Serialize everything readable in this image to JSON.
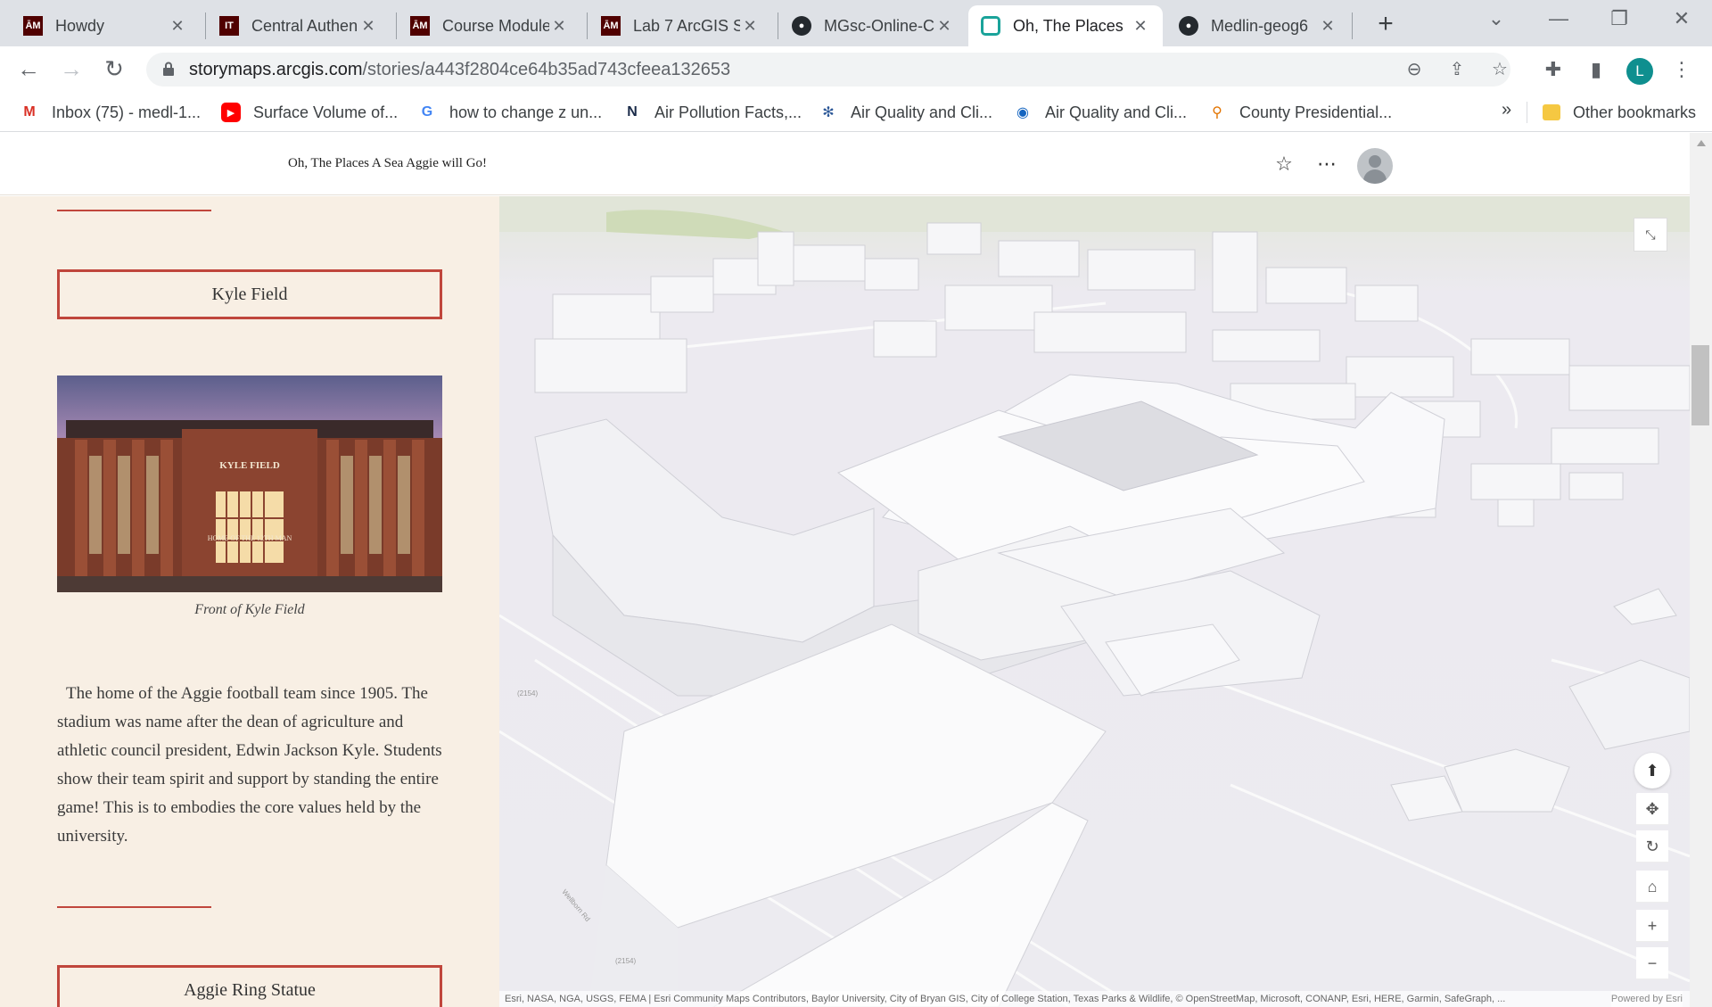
{
  "browser": {
    "tabs": [
      {
        "title": "Howdy",
        "icon": "tamu-icon",
        "active": false
      },
      {
        "title": "Central Authen",
        "icon": "it-icon",
        "active": false
      },
      {
        "title": "Course Module",
        "icon": "tamu-icon",
        "active": false
      },
      {
        "title": "Lab 7 ArcGIS S",
        "icon": "tamu-icon",
        "active": false
      },
      {
        "title": "MGsc-Online-C",
        "icon": "github-icon",
        "active": false
      },
      {
        "title": "Oh, The Places",
        "icon": "storymaps-icon",
        "active": true
      },
      {
        "title": "Medlin-geog6",
        "icon": "github-icon",
        "active": false
      }
    ],
    "url_domain": "storymaps.arcgis.com",
    "url_path": "/stories/a443f2804ce64b35ad743cfeea132653",
    "profile_initial": "L",
    "bookmarks": [
      {
        "label": "Inbox (75) - medl-1...",
        "icon": "gmail-icon",
        "color": "#d93025"
      },
      {
        "label": "Surface Volume of...",
        "icon": "youtube-icon",
        "color": "#ff0000"
      },
      {
        "label": "how to change z un...",
        "icon": "google-icon",
        "color": "#4285f4"
      },
      {
        "label": "Air Pollution Facts,...",
        "icon": "n-icon",
        "color": "#1a2b49"
      },
      {
        "label": "Air Quality and Cli...",
        "icon": "snowflake-icon",
        "color": "#2b5797"
      },
      {
        "label": "Air Quality and Cli...",
        "icon": "globe-icon",
        "color": "#1565c0"
      },
      {
        "label": "County Presidential...",
        "icon": "pin-icon",
        "color": "#e37400"
      }
    ],
    "bookmarks_more": "»",
    "other_bookmarks": "Other bookmarks"
  },
  "story": {
    "title": "Oh, The Places A Sea Aggie will Go!",
    "sections": [
      {
        "heading": "Kyle Field",
        "photo_sign_top": "KYLE FIELD",
        "photo_sign_bottom": "HOME OF THE 12TH MAN",
        "caption": "Front of Kyle Field",
        "text": "The home of the Aggie football team since 1905. The stadium was name after the dean of agriculture and athletic council president, Edwin Jackson Kyle. Students show their team spirit and support by standing the entire game! This is to embodies the core values held by the university."
      },
      {
        "heading": "Aggie Ring Statue"
      }
    ]
  },
  "map": {
    "attribution": "Esri, NASA, NGA, USGS, FEMA | Esri Community Maps Contributors, Baylor University, City of Bryan GIS, City of College Station, Texas Parks & Wildlife, © OpenStreetMap, Microsoft, CONANP, Esri, HERE, Garmin, SafeGraph, ...",
    "powered_by": "Powered by Esri",
    "road_labels": [
      "(2154)",
      "(2154)",
      "Wellborn Rd"
    ]
  },
  "colors": {
    "accent": "#c0463c",
    "panel_bg": "#f8efe4",
    "map_bg": "#ebe9ee"
  }
}
